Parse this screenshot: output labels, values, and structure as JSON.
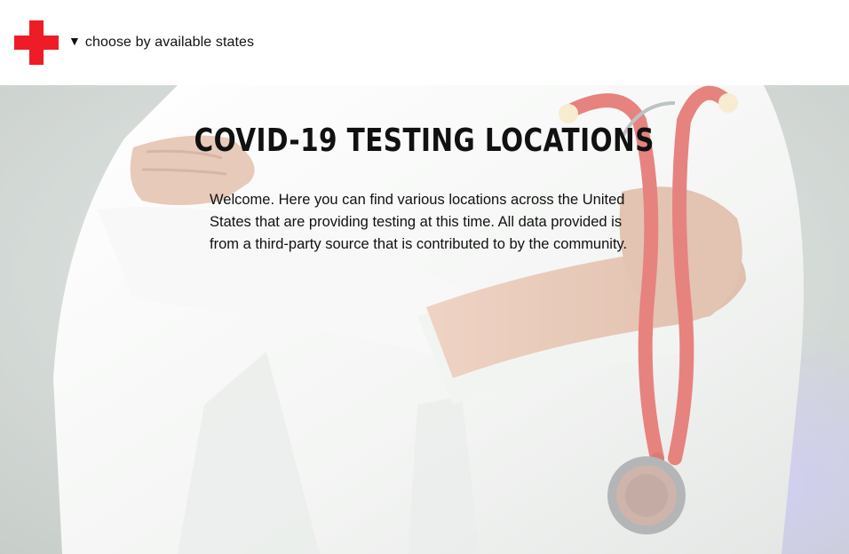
{
  "header": {
    "logo_icon": "red-cross-icon",
    "logo_color": "#ee1c25",
    "dropdown": {
      "caret_icon": "triangle-down-icon",
      "caret": "▼",
      "label": "choose by available states"
    }
  },
  "hero": {
    "background_image": "doctor-with-stethoscope-photo",
    "title": "COVID-19 TESTING LOCATIONS",
    "description": "Welcome. Here you can find various locations across the United States that are providing testing at this time. All data provided is from a third-party source that is contributed to by the community."
  }
}
